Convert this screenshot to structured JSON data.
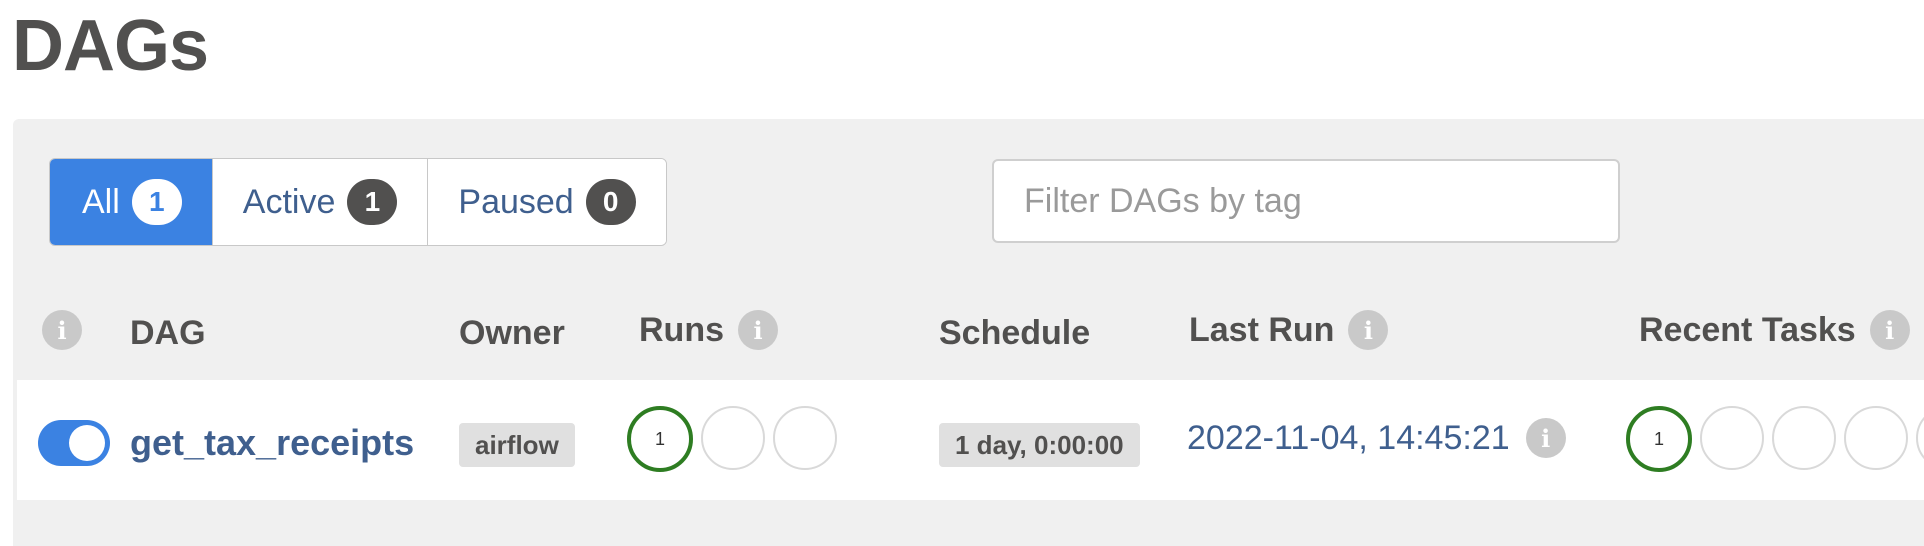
{
  "page": {
    "title": "DAGs"
  },
  "status_filter": {
    "buttons": [
      {
        "label": "All",
        "count": "1",
        "active": true
      },
      {
        "label": "Active",
        "count": "1",
        "active": false
      },
      {
        "label": "Paused",
        "count": "0",
        "active": false
      }
    ]
  },
  "tag_filter": {
    "placeholder": "Filter DAGs by tag",
    "value": ""
  },
  "table": {
    "columns": {
      "dag": "DAG",
      "owner": "Owner",
      "runs": "Runs",
      "schedule": "Schedule",
      "last_run": "Last Run",
      "recent_tasks": "Recent Tasks"
    },
    "info_icon_glyph": "i",
    "rows": [
      {
        "dag_id": "get_tax_receipts",
        "enabled": true,
        "owner": "airflow",
        "runs": [
          "1",
          "",
          ""
        ],
        "schedule": "1 day, 0:00:00",
        "last_run": "2022-11-04, 14:45:21",
        "recent_tasks": [
          "1",
          "",
          "",
          "",
          ""
        ]
      }
    ]
  },
  "colors": {
    "primary": "#3b82e2",
    "link": "#3f5f8e",
    "success": "#2e7d22",
    "panel_bg": "#f0f0f0",
    "text": "#51504f"
  },
  "icons": {
    "info": "info-icon",
    "toggle": "toggle-switch"
  }
}
